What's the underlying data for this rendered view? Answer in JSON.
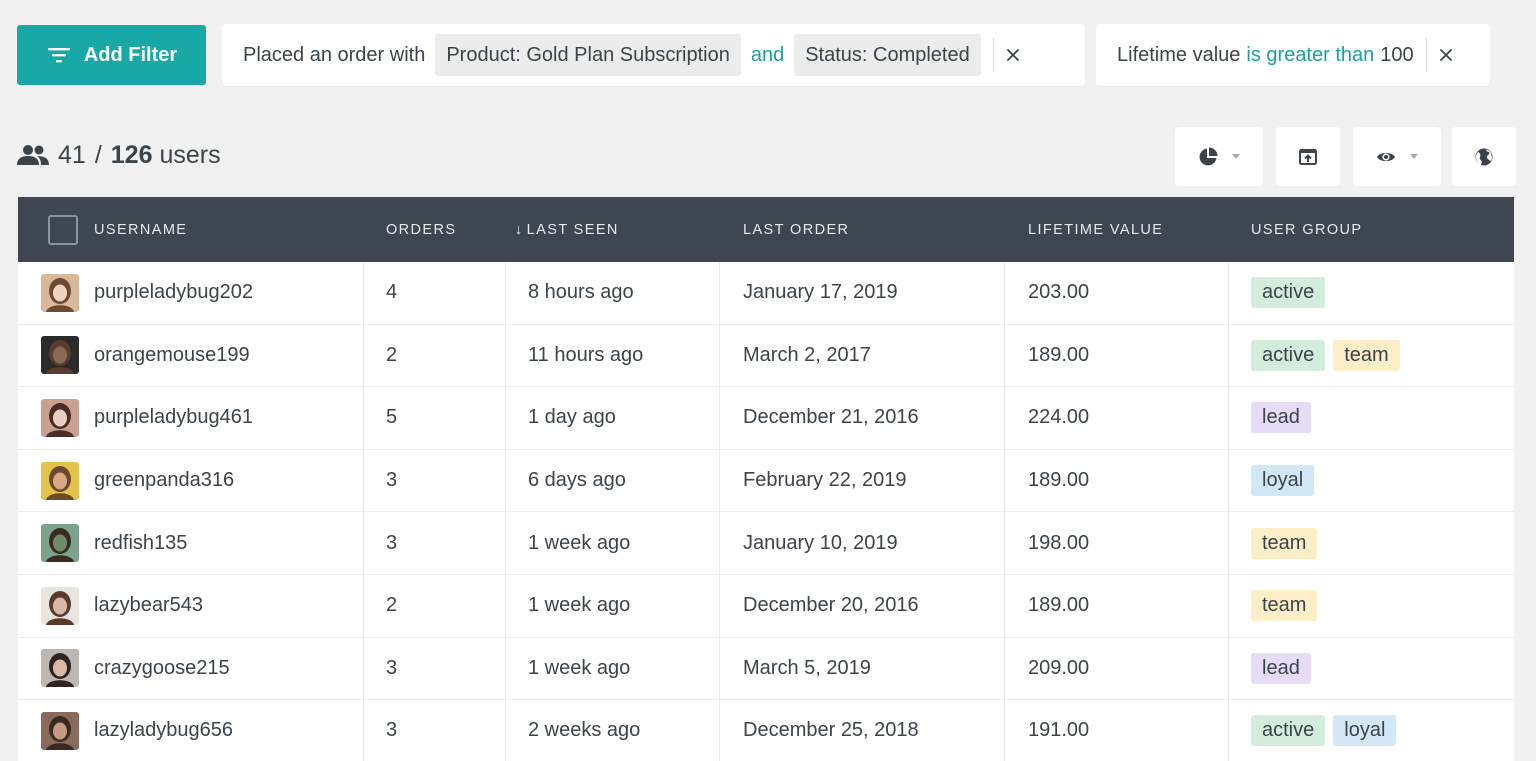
{
  "filters": {
    "add_label": "Add Filter",
    "filter1": {
      "prefix": "Placed an order with",
      "chip1": "Product: Gold Plan Subscription",
      "operator": "and",
      "chip2": "Status: Completed"
    },
    "filter2": {
      "field": "Lifetime value",
      "operator": "is greater than",
      "value": "100"
    }
  },
  "summary": {
    "shown": "41",
    "separator": "/",
    "total": "126",
    "unit": "users"
  },
  "toolbar": {
    "icons": [
      "pie-chart-icon",
      "export-icon",
      "eye-icon",
      "globe-icon"
    ]
  },
  "table": {
    "headers": {
      "username": "USERNAME",
      "orders": "ORDERS",
      "last_seen": "LAST SEEN",
      "sort_arrow": "↓",
      "last_order": "LAST ORDER",
      "lifetime_value": "LIFETIME VALUE",
      "user_group": "USER GROUP"
    },
    "rows": [
      {
        "username": "purpleladybug202",
        "orders": "4",
        "last_seen": "8 hours ago",
        "last_order": "January 17, 2019",
        "ltv": "203.00",
        "groups": [
          "active"
        ]
      },
      {
        "username": "orangemouse199",
        "orders": "2",
        "last_seen": "11 hours ago",
        "last_order": "March 2, 2017",
        "ltv": "189.00",
        "groups": [
          "active",
          "team"
        ]
      },
      {
        "username": "purpleladybug461",
        "orders": "5",
        "last_seen": "1 day ago",
        "last_order": "December 21, 2016",
        "ltv": "224.00",
        "groups": [
          "lead"
        ]
      },
      {
        "username": "greenpanda316",
        "orders": "3",
        "last_seen": "6 days ago",
        "last_order": "February 22, 2019",
        "ltv": "189.00",
        "groups": [
          "loyal"
        ]
      },
      {
        "username": "redfish135",
        "orders": "3",
        "last_seen": "1 week ago",
        "last_order": "January 10, 2019",
        "ltv": "198.00",
        "groups": [
          "team"
        ]
      },
      {
        "username": "lazybear543",
        "orders": "2",
        "last_seen": "1 week ago",
        "last_order": "December 20, 2016",
        "ltv": "189.00",
        "groups": [
          "team"
        ]
      },
      {
        "username": "crazygoose215",
        "orders": "3",
        "last_seen": "1 week ago",
        "last_order": "March 5, 2019",
        "ltv": "209.00",
        "groups": [
          "lead"
        ]
      },
      {
        "username": "lazyladybug656",
        "orders": "3",
        "last_seen": "2 weeks ago",
        "last_order": "December 25, 2018",
        "ltv": "191.00",
        "groups": [
          "active",
          "loyal"
        ]
      }
    ]
  },
  "colors": {
    "accent": "#19a8a8",
    "header_bg": "#3d4651",
    "tag_active": "#d3ecdc",
    "tag_team": "#fcefc7",
    "tag_lead": "#e6dcf7",
    "tag_loyal": "#d3e8f7"
  }
}
